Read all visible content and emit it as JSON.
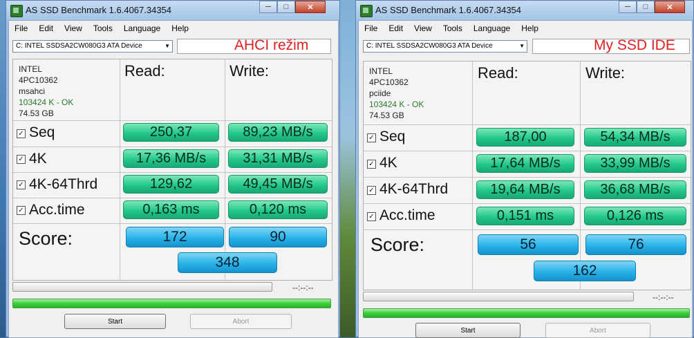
{
  "windows": [
    {
      "title": "AS SSD Benchmark 1.6.4067.34354",
      "menu": [
        "File",
        "Edit",
        "View",
        "Tools",
        "Language",
        "Help"
      ],
      "device": "C: INTEL SSDSA2CW080G3 ATA Device",
      "mode_label": "AHCI režim",
      "info": {
        "vendor": "INTEL",
        "firmware": "4PC10362",
        "driver": "msahci",
        "alignment": "103424 K - OK",
        "size": "74.53 GB"
      },
      "read_header": "Read:",
      "write_header": "Write:",
      "rows": [
        {
          "label": "Seq",
          "read": "250,37",
          "write": "89,23 MB/s"
        },
        {
          "label": "4K",
          "read": "17,36 MB/s",
          "write": "31,31 MB/s"
        },
        {
          "label": "4K-64Thrd",
          "read": "129,62",
          "write": "49,45 MB/s"
        },
        {
          "label": "Acc.time",
          "read": "0,163 ms",
          "write": "0,120 ms"
        }
      ],
      "score_label": "Score:",
      "score_read": "172",
      "score_write": "90",
      "score_total": "348",
      "timer": "--:--:--",
      "start_label": "Start",
      "abort_label": "Abort",
      "progress_top": 0,
      "progress_bottom": 1
    },
    {
      "title": "AS SSD Benchmark 1.6.4067.34354",
      "menu": [
        "File",
        "Edit",
        "View",
        "Tools",
        "Language",
        "Help"
      ],
      "device": "C: INTEL SSDSA2CW080G3 ATA Device",
      "mode_label": "My SSD IDE",
      "info": {
        "vendor": "INTEL",
        "firmware": "4PC10362",
        "driver": "pciide",
        "alignment": "103424 K - OK",
        "size": "74.53 GB"
      },
      "read_header": "Read:",
      "write_header": "Write:",
      "rows": [
        {
          "label": "Seq",
          "read": "187,00",
          "write": "54,34 MB/s"
        },
        {
          "label": "4K",
          "read": "17,64 MB/s",
          "write": "33,99 MB/s"
        },
        {
          "label": "4K-64Thrd",
          "read": "19,64 MB/s",
          "write": "36,68 MB/s"
        },
        {
          "label": "Acc.time",
          "read": "0,151 ms",
          "write": "0,126 ms"
        }
      ],
      "score_label": "Score:",
      "score_read": "56",
      "score_write": "76",
      "score_total": "162",
      "timer": "--:--:--",
      "start_label": "Start",
      "abort_label": "Abort",
      "progress_top": 0,
      "progress_bottom": 1
    }
  ]
}
